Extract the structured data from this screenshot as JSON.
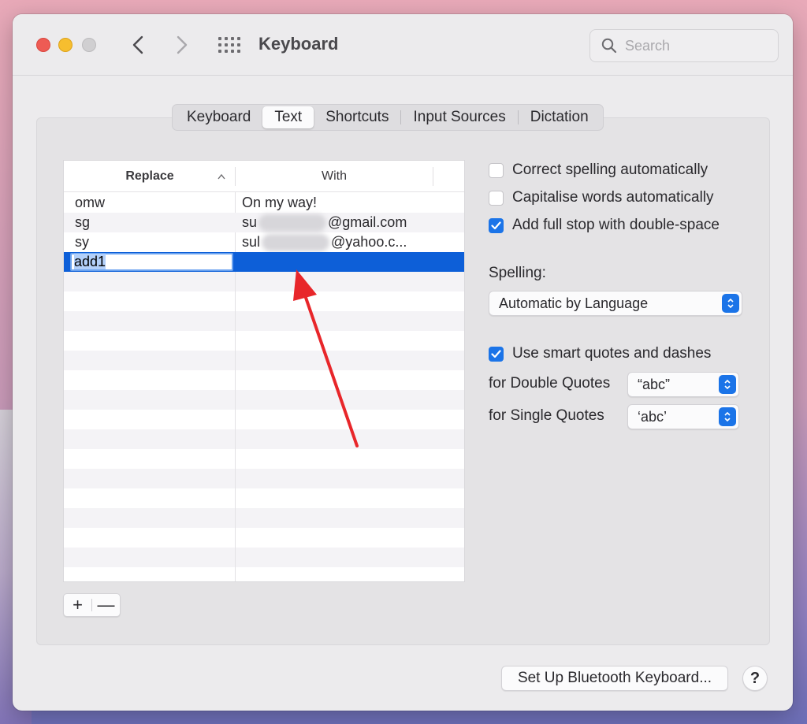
{
  "window": {
    "title": "Keyboard",
    "search_placeholder": "Search"
  },
  "tabs": [
    {
      "label": "Keyboard",
      "active": false
    },
    {
      "label": "Text",
      "active": true
    },
    {
      "label": "Shortcuts",
      "active": false
    },
    {
      "label": "Input Sources",
      "active": false
    },
    {
      "label": "Dictation",
      "active": false
    }
  ],
  "table": {
    "header_replace": "Replace",
    "header_with": "With",
    "rows": [
      {
        "replace": "omw",
        "with": "On my way!"
      },
      {
        "replace": "sg",
        "with_prefix": "su",
        "with_suffix": "@gmail.com"
      },
      {
        "replace": "sy",
        "with_prefix": "sul",
        "with_suffix": "@yahoo.c..."
      }
    ],
    "editing_row": {
      "replace": "add1",
      "with": ""
    }
  },
  "buttons": {
    "add": "+",
    "remove": "—",
    "bluetooth": "Set Up Bluetooth Keyboard...",
    "help": "?"
  },
  "options": {
    "correct_spelling": {
      "label": "Correct spelling automatically",
      "checked": false
    },
    "capitalise": {
      "label": "Capitalise words automatically",
      "checked": false
    },
    "full_stop": {
      "label": "Add full stop with double-space",
      "checked": true
    },
    "spelling_label": "Spelling:",
    "spelling_value": "Automatic by Language",
    "smart_quotes": {
      "label": "Use smart quotes and dashes",
      "checked": true
    },
    "double_quotes_label": "for Double Quotes",
    "double_quotes_value": "“abc”",
    "single_quotes_label": "for Single Quotes",
    "single_quotes_value": "‘abc’"
  },
  "colors": {
    "accent": "#1b74e8",
    "selection": "#0d5fd8",
    "annotation_arrow": "#e8262a"
  }
}
